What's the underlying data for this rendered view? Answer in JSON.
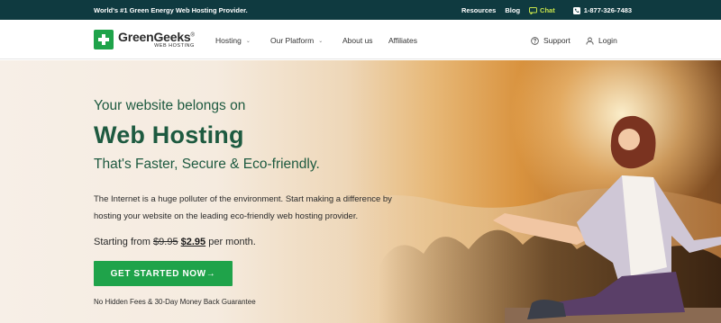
{
  "topbar": {
    "tagline": "World's #1 Green Energy Web Hosting Provider.",
    "resources": "Resources",
    "blog": "Blog",
    "chat": "Chat",
    "phone": "1-877-326-7483"
  },
  "logo": {
    "name": "GreenGeeks",
    "registered": "®",
    "sub": "WEB HOSTING"
  },
  "nav": {
    "hosting": "Hosting",
    "platform": "Our Platform",
    "about": "About us",
    "affiliates": "Affiliates",
    "support": "Support",
    "login": "Login"
  },
  "hero": {
    "pre_title": "Your website belongs on",
    "title": "Web Hosting",
    "subtitle": "That's Faster, Secure & Eco-friendly.",
    "description": "The Internet is a huge polluter of the environment. Start making a difference by hosting your website on the leading eco-friendly web hosting provider.",
    "price_prefix": "Starting from ",
    "old_price": "$9.95",
    "new_price": "$2.95",
    "price_suffix": " per month.",
    "cta": "GET STARTED NOW",
    "cta_arrow": "→",
    "guarantee": "No Hidden Fees & 30-Day Money Back Guarantee"
  },
  "colors": {
    "topbar_bg": "#0f3a40",
    "brand_green": "#1fa34a",
    "heading_green": "#1e5a40",
    "chat_accent": "#c7e44b"
  },
  "icons": {
    "chat": "chat-bubble-icon",
    "phone": "phone-icon",
    "support": "help-circle-icon",
    "login": "user-icon",
    "logo": "plus-icon"
  }
}
